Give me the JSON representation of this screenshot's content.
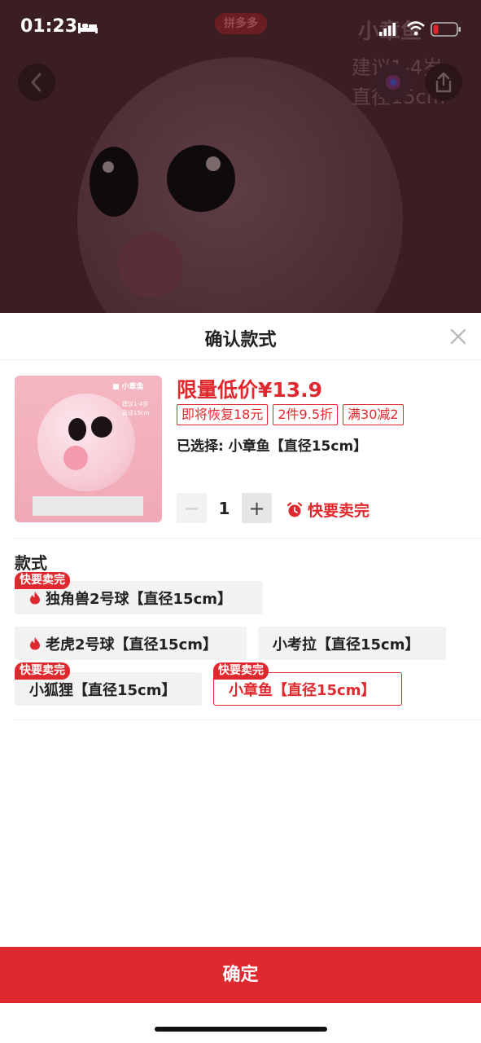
{
  "status_bar": {
    "time": "01:23",
    "icons": [
      "bed-icon",
      "signal-icon",
      "wifi-icon",
      "battery-icon"
    ]
  },
  "background_page": {
    "badge": "拼多多",
    "product_name": "小章鱼",
    "line1": "建议1-4岁",
    "line2": "直径15cm"
  },
  "sheet": {
    "title": "确认款式",
    "price": "限量低价¥13.9",
    "promo_tags": [
      "即将恢复18元",
      "2件9.5折",
      "满30减2"
    ],
    "selected_text": "已选择: 小章鱼【直径15cm】",
    "quantity": "1",
    "minus": "−",
    "plus": "+",
    "hot_label": "快要卖完",
    "image": {
      "tag": "小章鱼",
      "sub1": "建议1-4岁",
      "sub2": "直径15cm"
    }
  },
  "styles_section": {
    "title": "款式",
    "options": [
      {
        "label": "独角兽2号球【直径15cm】",
        "hot": true,
        "badge": "快要卖完",
        "selected": false
      },
      {
        "label": "老虎2号球【直径15cm】",
        "hot": true,
        "badge": "",
        "selected": false
      },
      {
        "label": "小考拉【直径15cm】",
        "hot": false,
        "badge": "",
        "selected": false
      },
      {
        "label": "小狐狸【直径15cm】",
        "hot": false,
        "badge": "快要卖完",
        "selected": false
      },
      {
        "label": "小章鱼【直径15cm】",
        "hot": false,
        "badge": "快要卖完",
        "selected": true
      }
    ]
  },
  "confirm_button": "确定",
  "colors": {
    "accent": "#e0292e",
    "backdrop": "#3a1e22"
  }
}
